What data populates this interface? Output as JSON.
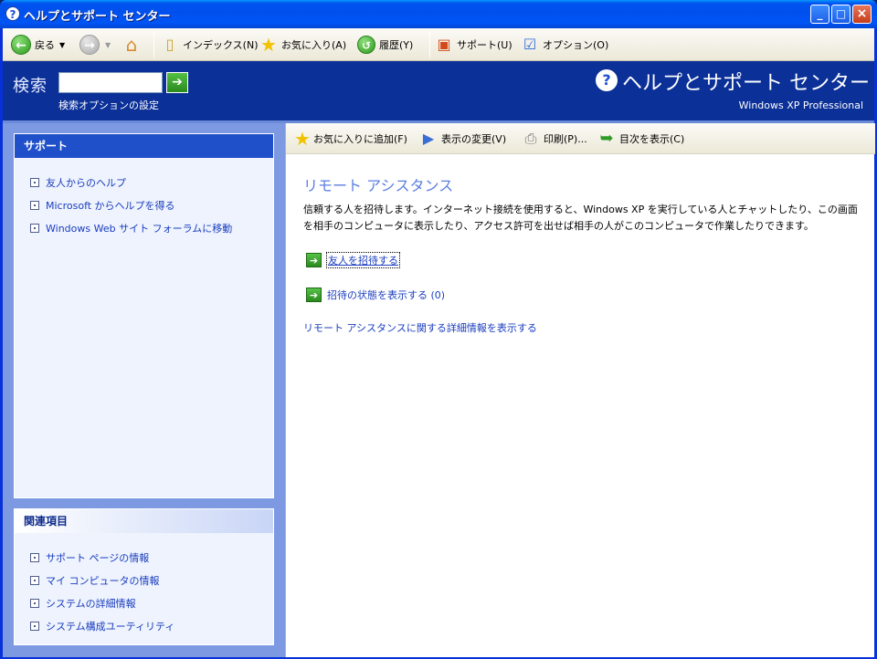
{
  "window": {
    "title": "ヘルプとサポート センター"
  },
  "toolbar": {
    "back_label": "戻る",
    "index_label": "インデックス(N)",
    "favorites_label": "お気に入り(A)",
    "history_label": "履歴(Y)",
    "support_label": "サポート(U)",
    "options_label": "オプション(O)"
  },
  "header": {
    "search_label": "検索",
    "search_value": "",
    "search_options": "検索オプションの設定",
    "brand_title": "ヘルプとサポート センター",
    "brand_sub": "Windows XP Professional"
  },
  "support_panel": {
    "title": "サポート",
    "items": [
      {
        "label": "友人からのヘルプ"
      },
      {
        "label": "Microsoft からヘルプを得る"
      },
      {
        "label": "Windows Web サイト フォーラムに移動"
      }
    ]
  },
  "related_panel": {
    "title": "関連項目",
    "items": [
      {
        "label": "サポート ページの情報"
      },
      {
        "label": "マイ コンピュータの情報"
      },
      {
        "label": "システムの詳細情報"
      },
      {
        "label": "システム構成ユーティリティ"
      }
    ]
  },
  "sub_toolbar": {
    "add_favorite": "お気に入りに追加(F)",
    "change_view": "表示の変更(V)",
    "print": "印刷(P)...",
    "show_toc": "目次を表示(C)"
  },
  "main": {
    "heading": "リモート アシスタンス",
    "description": "信頼する人を招待します。インターネット接続を使用すると、Windows XP を実行している人とチャットしたり、この画面を相手のコンピュータに表示したり、アクセス許可を出せば相手の人がこのコンピュータで作業したりできます。",
    "invite_label": "友人を招待する",
    "status_label": "招待の状態を表示する (0)",
    "more_info_label": "リモート アシスタンスに関する詳細情報を表示する"
  }
}
